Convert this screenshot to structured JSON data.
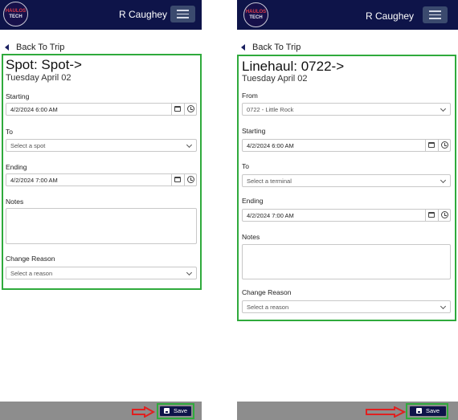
{
  "left": {
    "logo": {
      "line1": "HAULOS",
      "line2": "TECH"
    },
    "user_name": "R Caughey",
    "back_label": "Back To Trip",
    "title": "Spot: Spot->",
    "subtitle": "Tuesday April 02",
    "starting": {
      "label": "Starting",
      "value": "4/2/2024 6:00 AM"
    },
    "to": {
      "label": "To",
      "placeholder": "Select a spot"
    },
    "ending": {
      "label": "Ending",
      "value": "4/2/2024 7:00 AM"
    },
    "notes": {
      "label": "Notes"
    },
    "change_reason": {
      "label": "Change Reason",
      "placeholder": "Select a reason"
    },
    "save_label": "Save"
  },
  "right": {
    "logo": {
      "line1": "HAULOS",
      "line2": "TECH"
    },
    "user_name": "R Caughey",
    "back_label": "Back To Trip",
    "title": "Linehaul: 0722->",
    "subtitle": "Tuesday April 02",
    "from": {
      "label": "From",
      "value": "0722 - Little Rock"
    },
    "starting": {
      "label": "Starting",
      "value": "4/2/2024 6:00 AM"
    },
    "to": {
      "label": "To",
      "placeholder": "Select a terminal"
    },
    "ending": {
      "label": "Ending",
      "value": "4/2/2024 7:00 AM"
    },
    "notes": {
      "label": "Notes"
    },
    "change_reason": {
      "label": "Change Reason",
      "placeholder": "Select a reason"
    },
    "save_label": "Save"
  },
  "colors": {
    "navbar": "#0e1449",
    "highlight": "#2faa3c",
    "arrow": "#e02020",
    "footer": "#8d8d8d"
  }
}
